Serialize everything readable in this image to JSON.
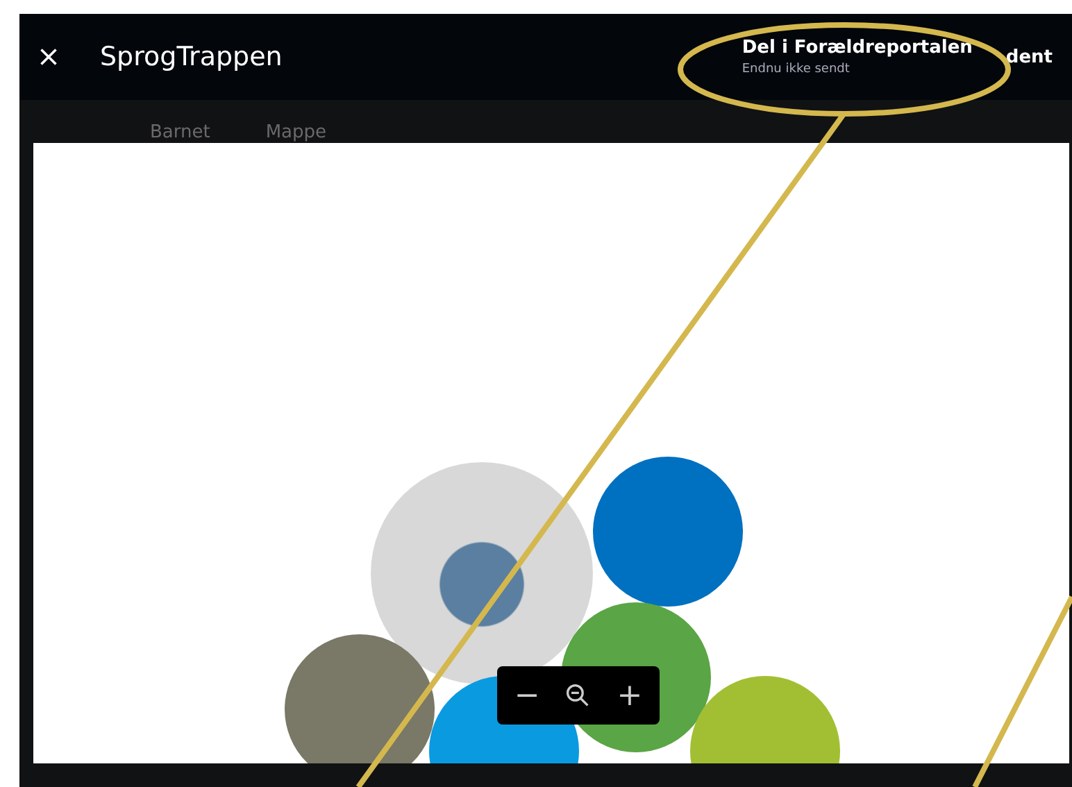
{
  "header": {
    "title": "SprogTrappen",
    "share_title": "Del i Forældreportalen",
    "share_status": "Endnu ikke sendt",
    "behind_text": "dent"
  },
  "background_tabs": [
    {
      "label": "Barnet"
    },
    {
      "label": "Mappe"
    }
  ],
  "circles": [
    {
      "kind": "photo"
    },
    {
      "kind": "color",
      "color": "#0070c0"
    },
    {
      "kind": "color",
      "color": "#5aa545"
    },
    {
      "kind": "color",
      "color": "#7a7866"
    },
    {
      "kind": "color",
      "color": "#0a9ae0"
    },
    {
      "kind": "color",
      "color": "#a2bf33"
    }
  ],
  "zoom_controls": {
    "minus": "−",
    "plus": "+"
  }
}
